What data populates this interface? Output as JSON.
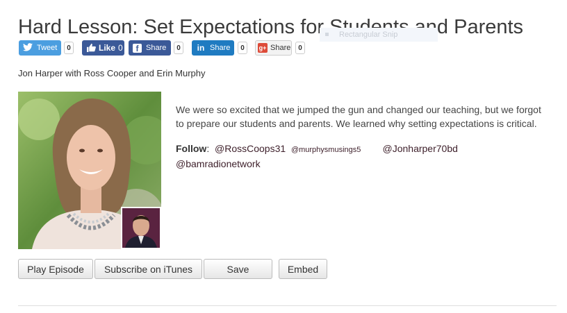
{
  "episode": {
    "title": "Hard Lesson: Set Expectations for Students and Parents",
    "byline": "Jon Harper with Ross Cooper and Erin Murphy",
    "description": "We were so excited that we jumped the gun and changed our teaching, but we forgot to prepare our students and parents. We learned why setting expectations is critical."
  },
  "overlay": {
    "snip_label": "Rectangular Snip"
  },
  "share": {
    "twitter": {
      "label": "Tweet",
      "count": "0"
    },
    "facebook_like": {
      "label": "Like",
      "count": "0"
    },
    "facebook_share": {
      "label": "Share",
      "count": "0"
    },
    "linkedin": {
      "label": "Share",
      "count": "0"
    },
    "google": {
      "label": "Share",
      "count": "0"
    }
  },
  "follow": {
    "label": "Follow",
    "colon": ":",
    "handles": [
      "@RossCoops31",
      "@murphysmusings5",
      "@Jonharper70bd",
      "@bamradionetwork"
    ]
  },
  "actions": {
    "play": "Play Episode",
    "subscribe": "Subscribe on iTunes",
    "save": "Save",
    "embed": "Embed"
  },
  "colors": {
    "twitter": "#4b9ee0",
    "facebook": "#3b5998",
    "linkedin": "#1f7bc1",
    "google": "#dd4b39",
    "handle": "#3d1f2a"
  },
  "icons": [
    "twitter-icon",
    "thumbs-up-icon",
    "facebook-icon",
    "linkedin-icon",
    "google-plus-icon"
  ]
}
